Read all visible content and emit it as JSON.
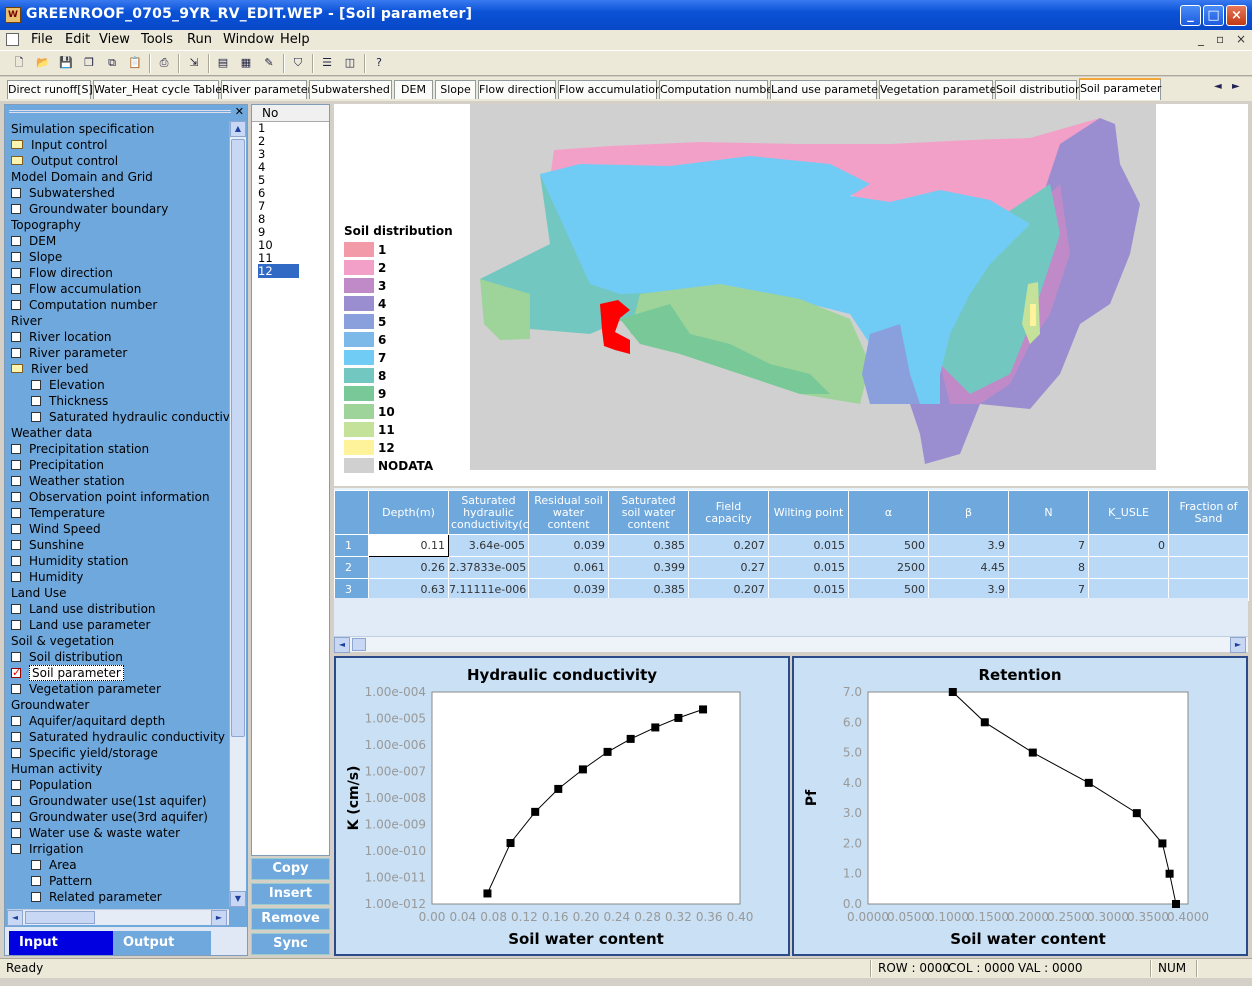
{
  "window": {
    "title": "GREENROOF_0705_9YR_RV_EDIT.WEP - [Soil parameter]",
    "min": "_",
    "max": "□",
    "close": "×"
  },
  "menu": {
    "items": [
      "File",
      "Edit",
      "View",
      "Tools",
      "Run",
      "Window",
      "Help"
    ],
    "mdi": [
      "_",
      "▫",
      "×"
    ]
  },
  "toolbar": {
    "icons": [
      "new-icon",
      "open-icon",
      "save-icon",
      "copy-icon",
      "copy2-icon",
      "paste-icon",
      "print-icon",
      "export-icon",
      "table-icon",
      "map-icon",
      "pen-icon",
      "run-icon",
      "layout-h-icon",
      "layout-v-icon",
      "help-icon"
    ]
  },
  "tabs": [
    "Direct runoff[S]",
    "Water_Heat cycle Table",
    "River parameter",
    "Subwatershed",
    "DEM",
    "Slope",
    "Flow direction",
    "Flow accumulation",
    "Computation number",
    "Land use parameter",
    "Vegetation parameter",
    "Soil distribution",
    "Soil parameter"
  ],
  "tabs_scroll": [
    "◄",
    "►"
  ],
  "tree": [
    {
      "t": "h",
      "label": "Simulation specification"
    },
    {
      "t": "f",
      "label": "Input control"
    },
    {
      "t": "f",
      "label": "Output control"
    },
    {
      "t": "h",
      "label": "Model Domain and Grid"
    },
    {
      "t": "c",
      "label": "Subwatershed"
    },
    {
      "t": "c",
      "label": "Groundwater boundary"
    },
    {
      "t": "h",
      "label": "Topography"
    },
    {
      "t": "c",
      "label": "DEM"
    },
    {
      "t": "c",
      "label": "Slope"
    },
    {
      "t": "c",
      "label": "Flow direction"
    },
    {
      "t": "c",
      "label": "Flow accumulation"
    },
    {
      "t": "c",
      "label": "Computation number"
    },
    {
      "t": "h",
      "label": "River"
    },
    {
      "t": "c",
      "label": "River location"
    },
    {
      "t": "c",
      "label": "River parameter"
    },
    {
      "t": "f",
      "label": "River bed"
    },
    {
      "t": "c2",
      "label": "Elevation"
    },
    {
      "t": "c2",
      "label": "Thickness"
    },
    {
      "t": "c2",
      "label": "Saturated hydraulic conductivity"
    },
    {
      "t": "h",
      "label": "Weather data"
    },
    {
      "t": "c",
      "label": "Precipitation station"
    },
    {
      "t": "c",
      "label": "Precipitation"
    },
    {
      "t": "c",
      "label": "Weather station"
    },
    {
      "t": "c",
      "label": "Observation point information"
    },
    {
      "t": "c",
      "label": "Temperature"
    },
    {
      "t": "c",
      "label": "Wind Speed"
    },
    {
      "t": "c",
      "label": "Sunshine"
    },
    {
      "t": "c",
      "label": "Humidity station"
    },
    {
      "t": "c",
      "label": "Humidity"
    },
    {
      "t": "h",
      "label": "Land Use"
    },
    {
      "t": "c",
      "label": "Land use distribution"
    },
    {
      "t": "c",
      "label": "Land use parameter"
    },
    {
      "t": "h",
      "label": "Soil & vegetation"
    },
    {
      "t": "c",
      "label": "Soil distribution"
    },
    {
      "t": "k",
      "label": "Soil parameter"
    },
    {
      "t": "c",
      "label": "Vegetation parameter"
    },
    {
      "t": "h",
      "label": "Groundwater"
    },
    {
      "t": "c",
      "label": "Aquifer/aquitard depth"
    },
    {
      "t": "c",
      "label": "Saturated hydraulic conductivity"
    },
    {
      "t": "c",
      "label": "Specific yield/storage"
    },
    {
      "t": "h",
      "label": "Human activity"
    },
    {
      "t": "c",
      "label": "Population"
    },
    {
      "t": "c",
      "label": "Groundwater use(1st aquifer)"
    },
    {
      "t": "c",
      "label": "Groundwater use(3rd aquifer)"
    },
    {
      "t": "c",
      "label": "Water use & waste water"
    },
    {
      "t": "c",
      "label": "Irrigation"
    },
    {
      "t": "c2",
      "label": "Area"
    },
    {
      "t": "c2",
      "label": "Pattern"
    },
    {
      "t": "c2",
      "label": "Related parameter"
    }
  ],
  "io_tabs": {
    "input": "Input",
    "output": "Output"
  },
  "nolist": {
    "header": "No",
    "items": [
      "1",
      "2",
      "3",
      "4",
      "5",
      "6",
      "7",
      "8",
      "9",
      "10",
      "11",
      "12"
    ],
    "selected": "12"
  },
  "side_buttons": [
    "Copy",
    "Insert",
    "Remove",
    "Sync"
  ],
  "legend": {
    "title": "Soil distribution",
    "items": [
      {
        "label": "1",
        "color": "#f39aa8"
      },
      {
        "label": "2",
        "color": "#f3a0c8"
      },
      {
        "label": "3",
        "color": "#c08ac8"
      },
      {
        "label": "4",
        "color": "#9a8ed0"
      },
      {
        "label": "5",
        "color": "#8aa0dc"
      },
      {
        "label": "6",
        "color": "#7cb8e8"
      },
      {
        "label": "7",
        "color": "#70ccf4"
      },
      {
        "label": "8",
        "color": "#72c8c0"
      },
      {
        "label": "9",
        "color": "#78c898"
      },
      {
        "label": "10",
        "color": "#9ed49a"
      },
      {
        "label": "11",
        "color": "#c4e29a"
      },
      {
        "label": "12",
        "color": "#fef29a"
      },
      {
        "label": "NODATA",
        "color": "#d0d0d0"
      }
    ]
  },
  "grid": {
    "columns": [
      "",
      "Depth(m)",
      "Saturated hydraulic conductivity(cm",
      "Residual soil water content",
      "Saturated soil water content",
      "Field capacity",
      "Wilting point",
      "α",
      "β",
      "N",
      "K_USLE",
      "Fraction of Sand"
    ],
    "rows": [
      [
        "1",
        "0.11",
        "3.64e-005",
        "0.039",
        "0.385",
        "0.207",
        "0.015",
        "500",
        "3.9",
        "7",
        "0",
        ""
      ],
      [
        "2",
        "0.26",
        "2.37833e-005",
        "0.061",
        "0.399",
        "0.27",
        "0.015",
        "2500",
        "4.45",
        "8",
        "",
        ""
      ],
      [
        "3",
        "0.63",
        "7.11111e-006",
        "0.039",
        "0.385",
        "0.207",
        "0.015",
        "500",
        "3.9",
        "7",
        "",
        ""
      ]
    ]
  },
  "chart_data": [
    {
      "type": "line",
      "title": "Hydraulic conductivity",
      "xlabel": "Soil water content",
      "ylabel": "K (cm/s)",
      "xlim": [
        0,
        0.4
      ],
      "yscale": "log",
      "ylim": [
        1e-12,
        0.0001
      ],
      "xticks": [
        "0.00",
        "0.04",
        "0.08",
        "0.12",
        "0.16",
        "0.20",
        "0.24",
        "0.28",
        "0.32",
        "0.36",
        "0.40"
      ],
      "yticks": [
        "1.00e-004",
        "1.00e-005",
        "1.00e-006",
        "1.00e-007",
        "1.00e-008",
        "1.00e-009",
        "1.00e-010",
        "1.00e-011",
        "1.00e-012"
      ],
      "x": [
        0.072,
        0.102,
        0.134,
        0.164,
        0.196,
        0.228,
        0.258,
        0.29,
        0.32,
        0.352
      ],
      "y": [
        2.5e-12,
        2e-10,
        3e-09,
        2.2e-08,
        1.2e-07,
        5.5e-07,
        1.7e-06,
        4.6e-06,
        1.05e-05,
        2.2e-05
      ]
    },
    {
      "type": "line",
      "title": "Retention",
      "xlabel": "Soil water content",
      "ylabel": "Pf",
      "xlim": [
        0,
        0.4
      ],
      "ylim": [
        0,
        7
      ],
      "xticks": [
        "0.0000",
        "0.0500",
        "0.1000",
        "0.1500",
        "0.2000",
        "0.2500",
        "0.3000",
        "0.3500",
        "0.4000"
      ],
      "yticks": [
        "7.0",
        "6.0",
        "5.0",
        "4.0",
        "3.0",
        "2.0",
        "1.0",
        "0.0"
      ],
      "x": [
        0.106,
        0.146,
        0.206,
        0.276,
        0.336,
        0.368,
        0.377,
        0.385
      ],
      "y": [
        7.0,
        6.0,
        5.0,
        4.0,
        3.0,
        2.0,
        1.0,
        0.0
      ]
    }
  ],
  "status": {
    "ready": "Ready",
    "row": "ROW : 0000",
    "col": "COL : 0000",
    "val": "VAL : 0000",
    "num": "NUM"
  }
}
